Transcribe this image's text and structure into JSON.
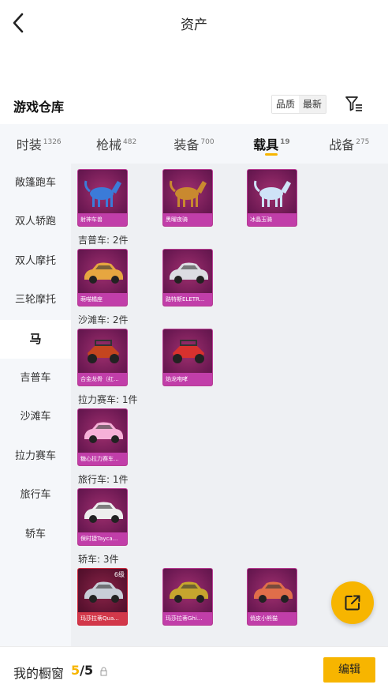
{
  "header": {
    "title": "资产"
  },
  "warehouse": {
    "title": "游戏仓库",
    "sort_options": [
      "品质",
      "最新"
    ],
    "filter_icon": "filter-icon"
  },
  "tabs": [
    {
      "label": "时装",
      "count": "1326"
    },
    {
      "label": "枪械",
      "count": "482"
    },
    {
      "label": "装备",
      "count": "700"
    },
    {
      "label": "载具",
      "count": "19",
      "active": true
    },
    {
      "label": "战备",
      "count": "275"
    }
  ],
  "sidebar": {
    "items": [
      "敞篷跑车",
      "双人轿跑",
      "双人摩托",
      "三轮摩托",
      "马",
      "吉普车",
      "沙滩车",
      "拉力赛车",
      "旅行车",
      "轿车"
    ],
    "active": "马"
  },
  "sections": [
    {
      "title": "",
      "items": [
        {
          "label": "射神车兽",
          "art": "beast"
        },
        {
          "label": "黑曜夜骑",
          "art": "beast"
        },
        {
          "label": "冰晶玉骑",
          "art": "beast"
        }
      ]
    },
    {
      "title": "吉普车: 2件",
      "items": [
        {
          "label": "萌喵橘座",
          "art": "car"
        },
        {
          "label": "路特斯ELETR...",
          "art": "car"
        }
      ]
    },
    {
      "title": "沙滩车: 2件",
      "items": [
        {
          "label": "合金龙骨（红...",
          "art": "kart"
        },
        {
          "label": "焰龙咆哮",
          "art": "kart"
        }
      ]
    },
    {
      "title": "拉力赛车: 1件",
      "items": [
        {
          "label": "糖心拉力赛车...",
          "art": "car"
        }
      ]
    },
    {
      "title": "旅行车: 1件",
      "items": [
        {
          "label": "保时捷Tayca...",
          "art": "car"
        }
      ]
    },
    {
      "title": "轿车: 3件",
      "items": [
        {
          "label": "玛莎拉蒂Qua...",
          "art": "car",
          "badge": "6级",
          "red": true
        },
        {
          "label": "玛莎拉蒂Ghi...",
          "art": "car"
        },
        {
          "label": "俏皮小熊猫",
          "art": "car"
        }
      ]
    }
  ],
  "art_colors": {
    "beast": [
      "#3b7bd8",
      "#c9892f",
      "#cfe3f7"
    ],
    "car": [
      "#e6a640",
      "#dcdce2",
      "#f6b1d8",
      "#eeeeee",
      "#c9ced8",
      "#c6a52e",
      "#e06e4a"
    ],
    "kart": [
      "#c4451f",
      "#d8312e"
    ]
  },
  "fab": {
    "icon": "share-icon"
  },
  "bottom": {
    "window_label": "我的橱窗",
    "count_current": "5",
    "count_total": "/5",
    "edit_label": "编辑"
  }
}
